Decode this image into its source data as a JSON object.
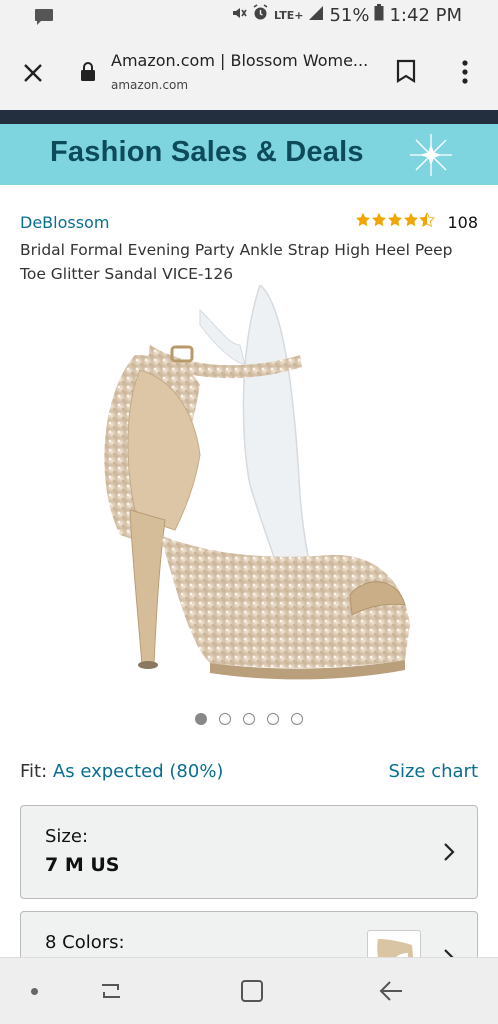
{
  "status_bar": {
    "network": "LTE+",
    "battery": "51%",
    "time": "1:42 PM"
  },
  "tab_bar": {
    "title": "Amazon.com | Blossom Wome...",
    "domain": "amazon.com"
  },
  "banner": {
    "text": "Fashion Sales & Deals"
  },
  "product": {
    "brand": "DeBlossom",
    "rating": 4.5,
    "rating_count": "108",
    "title": "Bridal Formal Evening Party Ankle Strap High Heel Peep Toe Glitter Sandal VICE-126",
    "image_count": 5,
    "active_image": 1
  },
  "fit": {
    "label": "Fit:",
    "value": "As expected (80%)",
    "size_chart": "Size chart"
  },
  "size_option": {
    "label": "Size:",
    "value": "7 M US"
  },
  "colors_option": {
    "label": "8 Colors:"
  },
  "colors": {
    "link": "#0a6f8f",
    "banner_bg": "#7fd5df",
    "banner_text": "#0e4b5a",
    "star": "#f0a500",
    "header_dark": "#232f3e"
  },
  "icons": {
    "close": "close-icon",
    "lock": "lock-icon",
    "bookmark": "bookmark-icon",
    "menu": "more-vert-icon",
    "chevron": "chevron-right-icon"
  }
}
